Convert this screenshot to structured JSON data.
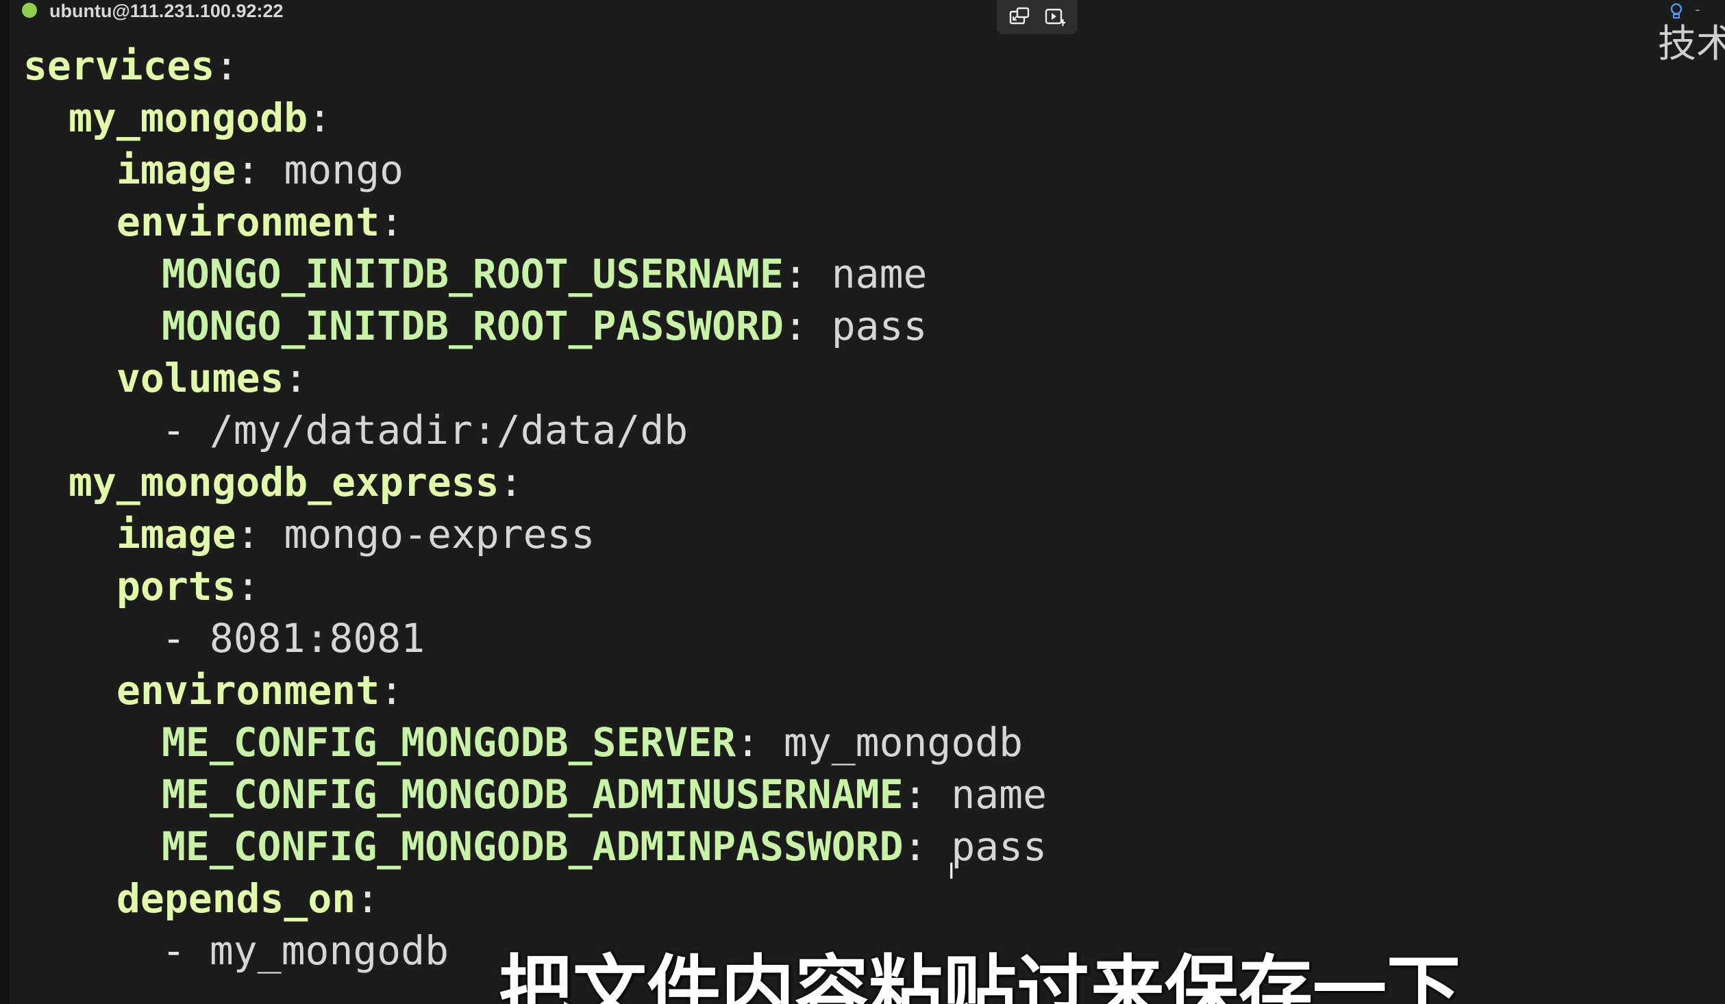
{
  "titlebar": {
    "session_title": "ubuntu@111.231.100.92:22",
    "status_color": "#8fd14f",
    "toolbar_icons": [
      "screen-switch-icon",
      "screen-record-icon"
    ]
  },
  "corner": {
    "icon": "lightbulb-icon",
    "dash": "-",
    "text": "技术"
  },
  "editor": {
    "colors": {
      "key": "#e0faaa",
      "value": "#d6d6d6",
      "background": "#1c1c1c"
    },
    "lines": [
      {
        "key": "services",
        "sep": ":"
      },
      {
        "key": "my_mongodb",
        "sep": ":"
      },
      {
        "key": "image",
        "sep": ": ",
        "value": "mongo"
      },
      {
        "key": "environment",
        "sep": ":"
      },
      {
        "key": "MONGO_INITDB_ROOT_USERNAME",
        "sep": ": ",
        "value": "name"
      },
      {
        "key": "MONGO_INITDB_ROOT_PASSWORD",
        "sep": ": ",
        "value": "pass"
      },
      {
        "key": "volumes",
        "sep": ":"
      },
      {
        "dash": "- ",
        "value": "/my/datadir:/data/db"
      },
      {
        "key": "my_mongodb_express",
        "sep": ":"
      },
      {
        "key": "image",
        "sep": ": ",
        "value": "mongo-express"
      },
      {
        "key": "ports",
        "sep": ":"
      },
      {
        "dash": "- ",
        "value": "8081:8081"
      },
      {
        "key": "environment",
        "sep": ":"
      },
      {
        "key": "ME_CONFIG_MONGODB_SERVER",
        "sep": ": ",
        "value": "my_mongodb"
      },
      {
        "key": "ME_CONFIG_MONGODB_ADMINUSERNAME",
        "sep": ": ",
        "value": "name"
      },
      {
        "key": "ME_CONFIG_MONGODB_ADMINPASSWORD",
        "sep": ": ",
        "value": "pass"
      },
      {
        "key": "depends_on",
        "sep": ":"
      },
      {
        "dash": "- ",
        "value": "my_mongodb"
      }
    ]
  },
  "cursor": {
    "glyph": "I"
  },
  "subtitle": {
    "text": "把文件内容粘贴过来保存一下"
  }
}
